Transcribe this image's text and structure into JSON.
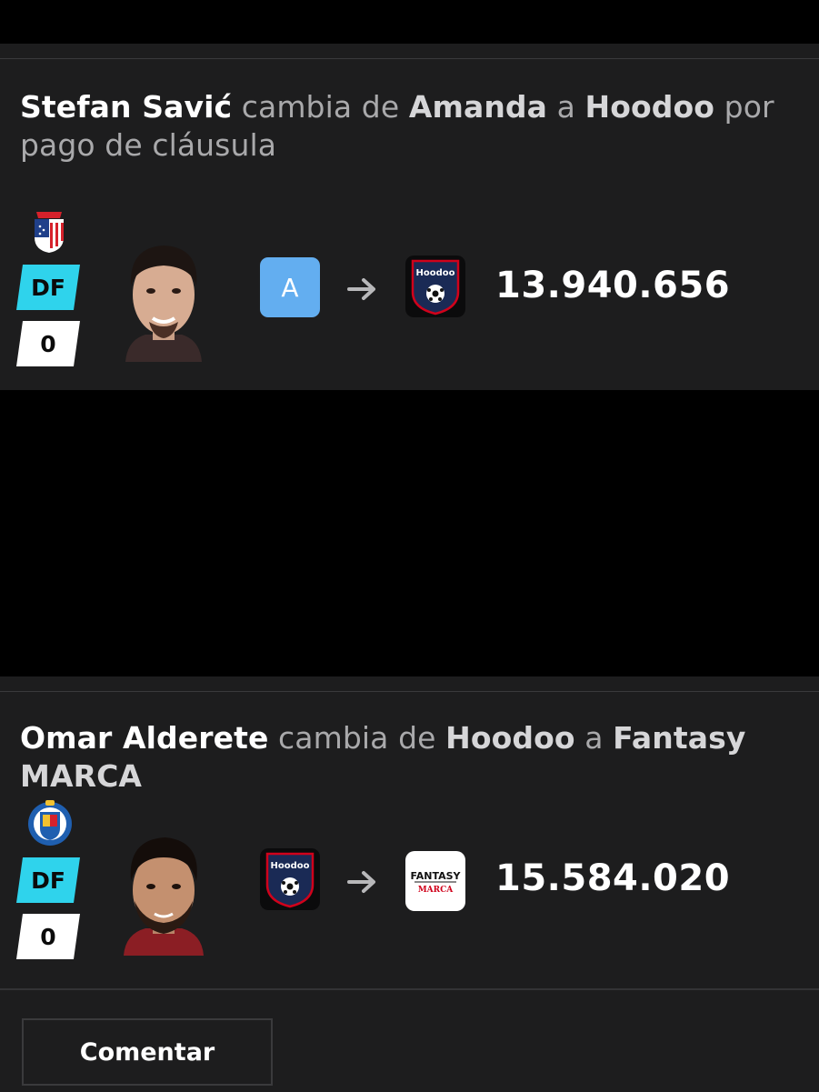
{
  "transfers": [
    {
      "player": "Stefan Savić",
      "verb": "cambia de",
      "from": "Amanda",
      "connector": "a",
      "to": "Hoodoo",
      "reason": "por pago de cláusula",
      "position": "DF",
      "points": "0",
      "from_badge": "A",
      "to_badge_text": "Hoodoo",
      "amount": "13.940.656",
      "club_crest_icon": "atletico-madrid-crest-icon"
    },
    {
      "player": "Omar Alderete",
      "verb": "cambia de",
      "from": "Hoodoo",
      "connector": "a",
      "to": "Fantasy MARCA",
      "reason": "",
      "position": "DF",
      "points": "0",
      "from_badge_text": "Hoodoo",
      "to_badge_text_top": "FANTASY",
      "to_badge_text_bottom": "MARCA",
      "amount": "15.584.020",
      "club_crest_icon": "getafe-crest-icon"
    }
  ],
  "actions": {
    "comment_label": "Comentar"
  },
  "colors": {
    "card_bg": "#1d1d1e",
    "position_badge": "#2fd3ec",
    "avatar_a": "#63aef0",
    "hoodoo_shield": "#1a2a55",
    "marca_red": "#d0021b"
  }
}
